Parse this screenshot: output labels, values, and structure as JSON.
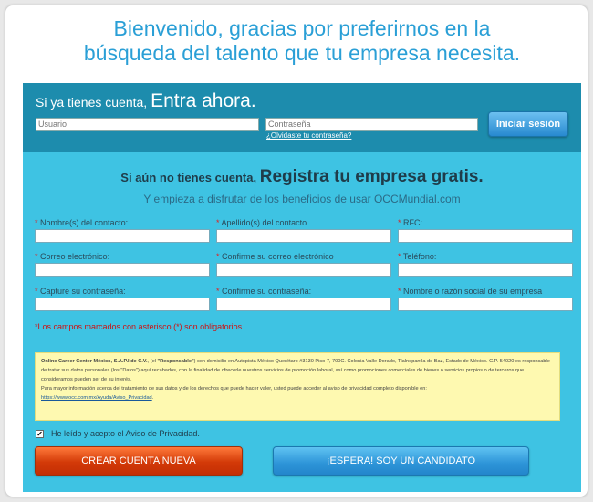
{
  "headline": {
    "line1": "Bienvenido, gracias por preferirnos en la",
    "line2": "búsqueda del talento que tu empresa necesita."
  },
  "login": {
    "title_small": "Si ya tienes cuenta, ",
    "title_big": "Entra ahora.",
    "username_placeholder": "Usuario",
    "password_placeholder": "Contraseña",
    "forgot_link": "¿Olvidaste tu contraseña?",
    "submit_label": "Iniciar sesión"
  },
  "register": {
    "title_small": "Si aún no tienes cuenta, ",
    "title_big": "Registra tu empresa gratis.",
    "subtitle": "Y empieza a disfrutar de los beneficios de usar OCCMundial.com",
    "asterisk": "*",
    "fields": [
      {
        "label": "Nombre(s) del contacto:"
      },
      {
        "label": "Apellido(s) del contacto"
      },
      {
        "label": "RFC:"
      },
      {
        "label": "Correo electrónico:"
      },
      {
        "label": "Confirme su correo electrónico"
      },
      {
        "label": "Teléfono:"
      },
      {
        "label": "Capture su contraseña:"
      },
      {
        "label": "Confirme su contraseña:"
      },
      {
        "label": "Nombre o razón social de su empresa"
      }
    ],
    "required_note": "*Los campos marcados con asterisco (*) son obligatorios",
    "privacy": {
      "company": "Online Career Center México, S.A.P.I de C.V.",
      "part1": ", (el ",
      "responsable": "\"Responsable\"",
      "part2": ") con domicilio en Autopista México Querétaro #3130 Piso 7, 700C. Colonia Valle Dorado, Tlalnepantla de Baz, Estado de México. C.P. 54020 es responsable de tratar sus datos personales (los \"Datos\") aquí recabados, con la finalidad de ofrecerle nuestros servicios de promoción laboral, así como promociones comerciales de bienes o servicios propios o de terceros que consideramos pueden ser de su interés.",
      "part3": "Para mayor información acerca del tratamiento de sus datos y de los derechos que puede hacer valer, usted puede acceder al aviso de privacidad completo disponible en:",
      "link": "https://www.occ.com.mx/Ayuda/Aviso_Privacidad",
      "end": "."
    },
    "consent_label": "He leído y acepto el Aviso de Privacidad.",
    "consent_checked": "✔",
    "create_button": "CREAR CUENTA NUEVA",
    "candidate_button": "¡ESPERA! SOY UN CANDIDATO"
  },
  "colors": {
    "headline": "#2a9fd6",
    "login_bg": "#1d8cad",
    "register_bg": "#3ec3e3",
    "create_button": "#d33a08",
    "candidate_button": "#2d94d8",
    "privacy_bg": "#fef9b0"
  }
}
